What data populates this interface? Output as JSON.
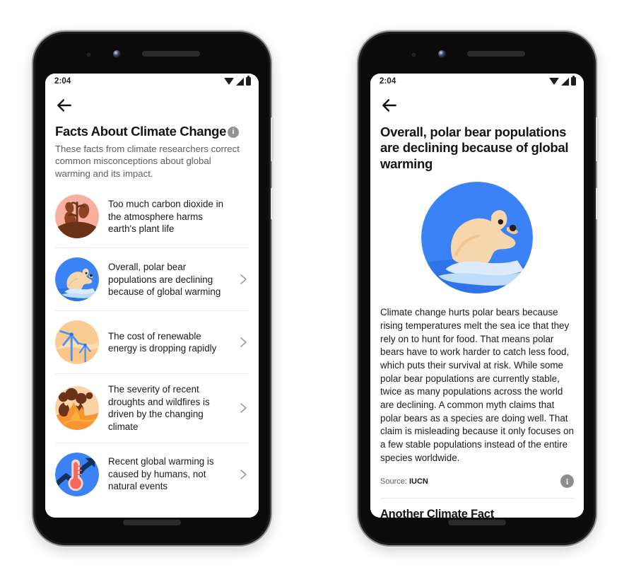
{
  "theme": {
    "accent_blue": "#3B82F6",
    "pink": "#F8AFA0",
    "brown": "#7A3B1E",
    "peach": "#FBCB94",
    "orange": "#F79433",
    "bear_cream": "#F6D6AA",
    "ice": "#CFE4F7",
    "info_gray": "#939393",
    "text_primary": "#1A1A1A",
    "text_secondary": "#5D5D5D",
    "divider": "#EAEAEA"
  },
  "left_phone": {
    "status_bar": {
      "time": "2:04",
      "icons": [
        "wifi-icon",
        "signal-icon",
        "battery-icon"
      ]
    },
    "appbar": {
      "back_icon": "back-arrow-icon"
    },
    "title": "Facts About Climate Change",
    "info_badge": "i",
    "subtitle": "These facts from climate researchers correct common misconceptions about global warming and its impact.",
    "facts": [
      {
        "text": "Too much carbon dioxide in the atmosphere harms earth's plant life",
        "icon": "wilting-plant-icon",
        "has_chevron": false
      },
      {
        "text": "Overall, polar bear populations are declining because of global warming",
        "icon": "polar-bear-icon",
        "has_chevron": true
      },
      {
        "text": "The cost of renewable energy is dropping rapidly",
        "icon": "wind-turbine-icon",
        "has_chevron": true
      },
      {
        "text": "The severity of recent droughts and wildfires is driven by the changing climate",
        "icon": "wildfire-icon",
        "has_chevron": true
      },
      {
        "text": "Recent global warming is caused by humans, not natural events",
        "icon": "thermometer-rising-icon",
        "has_chevron": true
      }
    ]
  },
  "right_phone": {
    "status_bar": {
      "time": "2:04",
      "icons": [
        "wifi-icon",
        "signal-icon",
        "battery-icon"
      ]
    },
    "appbar": {
      "back_icon": "back-arrow-icon"
    },
    "title": "Overall, polar bear populations are declining because of global warming",
    "hero_icon": "polar-bear-icon",
    "body": "Climate change hurts polar bears because rising temperatures melt the sea ice that they rely on to hunt for food. That means polar bears have to work harder to catch less food, which puts their survival at risk. While some polar bear populations are currently stable, twice as many populations across the world are declining. A common myth claims that polar bears as a species are doing well. That claim is misleading because it only focuses on a few stable populations instead of the entire species worldwide.",
    "source_label": "Source:",
    "source_name": "IUCN",
    "info_badge": "i",
    "next_section_heading": "Another Climate Fact"
  }
}
